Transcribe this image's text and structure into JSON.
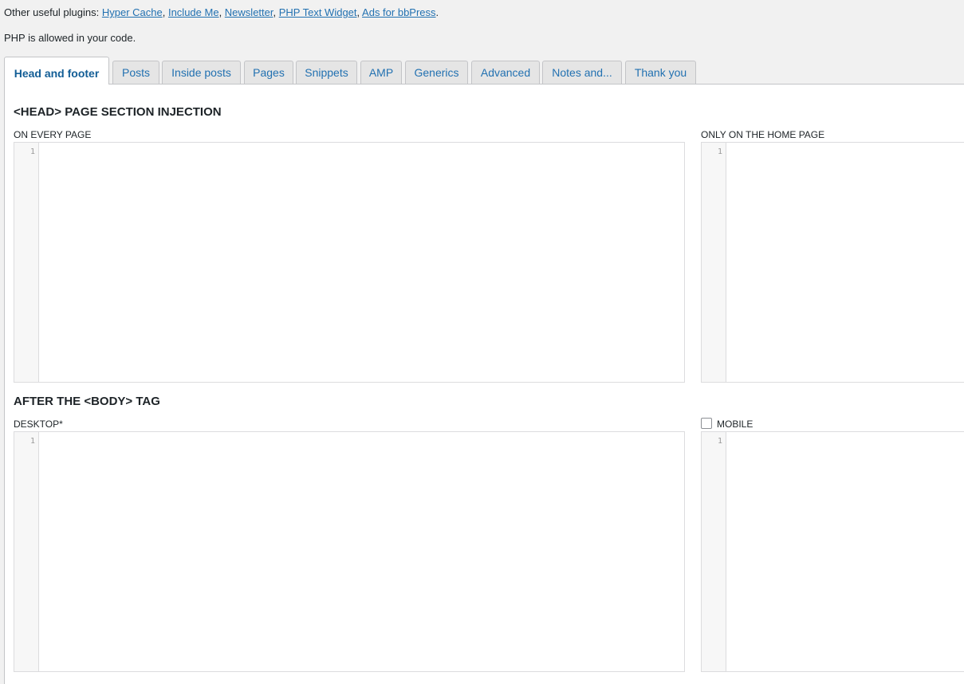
{
  "header": {
    "other_plugins_prefix": "Other useful plugins: ",
    "plugins": [
      "Hyper Cache",
      "Include Me",
      "Newsletter",
      "PHP Text Widget",
      "Ads for bbPress"
    ],
    "php_note": "PHP is allowed in your code."
  },
  "tabs": [
    {
      "label": "Head and footer",
      "active": true
    },
    {
      "label": "Posts"
    },
    {
      "label": "Inside posts"
    },
    {
      "label": "Pages"
    },
    {
      "label": "Snippets"
    },
    {
      "label": "AMP"
    },
    {
      "label": "Generics"
    },
    {
      "label": "Advanced"
    },
    {
      "label": "Notes and..."
    },
    {
      "label": "Thank you"
    }
  ],
  "head_section": {
    "title": "<HEAD> PAGE SECTION INJECTION",
    "every_page_label": "ON EVERY PAGE",
    "home_page_label": "ONLY ON THE HOME PAGE",
    "every_page_value": "",
    "home_page_value": ""
  },
  "body_section": {
    "title": "AFTER THE <BODY> TAG",
    "desktop_label": "DESKTOP*",
    "mobile_label": "MOBILE",
    "mobile_checked": false,
    "desktop_value": "",
    "mobile_value": ""
  },
  "editor": {
    "first_line_number": "1"
  },
  "colors": {
    "link": "#2271b1",
    "active_tab": "#135e96",
    "background": "#f1f1f1"
  }
}
